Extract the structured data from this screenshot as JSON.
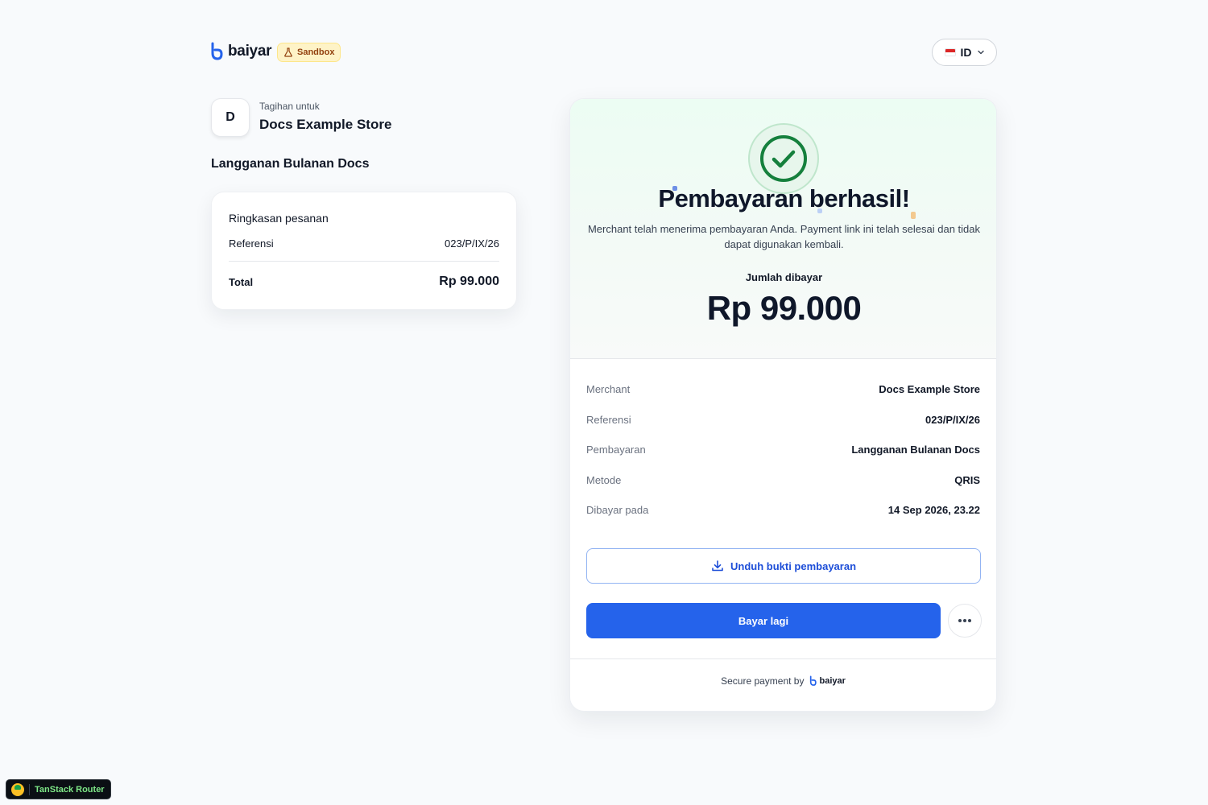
{
  "header": {
    "brand": "baiyar",
    "sandbox_label": "Sandbox",
    "language": "ID"
  },
  "invoice": {
    "avatar_letter": "D",
    "bill_for_label": "Tagihan untuk",
    "merchant_name": "Docs Example Store",
    "product_title": "Langganan Bulanan Docs"
  },
  "summary": {
    "title": "Ringkasan pesanan",
    "reference_label": "Referensi",
    "reference_value": "023/P/IX/26",
    "total_label": "Total",
    "total_value": "Rp 99.000"
  },
  "result": {
    "title": "Pembayaran berhasil!",
    "description": "Merchant telah menerima pembayaran Anda. Payment link ini telah selesai dan tidak dapat digunakan kembali.",
    "amount_label": "Jumlah dibayar",
    "amount_value": "Rp 99.000",
    "details": [
      {
        "label": "Merchant",
        "value": "Docs Example Store"
      },
      {
        "label": "Referensi",
        "value": "023/P/IX/26"
      },
      {
        "label": "Pembayaran",
        "value": "Langganan Bulanan Docs"
      },
      {
        "label": "Metode",
        "value": "QRIS"
      },
      {
        "label": "Dibayar pada",
        "value": "14 Sep 2026, 23.22"
      }
    ],
    "download_label": "Unduh bukti pembayaran",
    "pay_again_label": "Bayar lagi",
    "secure_label": "Secure payment by",
    "secure_brand": "baiyar"
  },
  "devtools": {
    "label": "TanStack Router"
  },
  "colors": {
    "primary": "#2563eb",
    "success": "#15803d",
    "background": "#f8fafc",
    "sandbox": "#fef3c7"
  },
  "icons": [
    "baiyar-logo-icon",
    "flask-icon",
    "id-flag-icon",
    "chevron-down-icon",
    "check-circle-icon",
    "download-icon",
    "more-horizontal-icon"
  ]
}
